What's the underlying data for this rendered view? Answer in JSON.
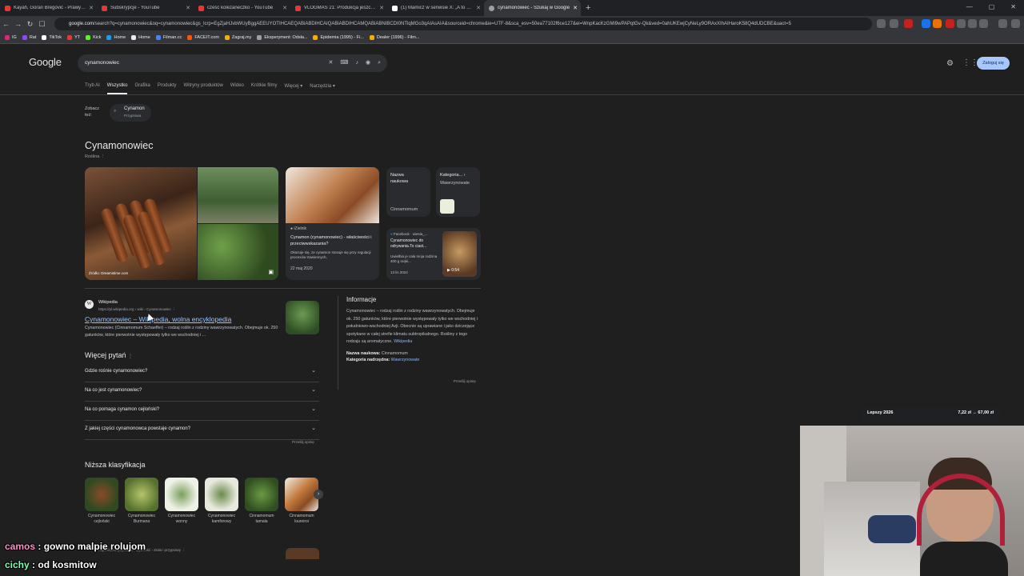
{
  "browser": {
    "tabs": [
      {
        "title": "Kayah, Goran Bregović - Prawy do",
        "color": "#e53935"
      },
      {
        "title": "Subskrypcje - YouTube",
        "color": "#e53935"
      },
      {
        "title": "cześć koleżaneczko - YouTube",
        "color": "#e53935"
      },
      {
        "title": "VLOGMAS 21: Produkcja jeszcze nie",
        "color": "#e53935"
      },
      {
        "title": "(1) Mamicz w serwisie X: „A to wiec",
        "color": "#ffffff"
      },
      {
        "title": "cynamonowiec - Szukaj w Google",
        "color": "#9aa0a6"
      }
    ],
    "url_site": "google.com",
    "url_rest": "/search?q=cynamonowiec&oq=cynamonowiec&gs_lcrp=EgZjaHJvbWUyBggAEEUYOTIHCAEQABiABDIHCAIQABiABDIHCAMQABiABNIBCDI0NTlqMGo3qAIAsAIA&sourceid=chrome&ie=UTF-8&sca_esv=50ea77102f6ce127&ei=WnpKacKzGMi9wPAPqtGv-Qk&ved=0ahUKEwjCyNeLy9ORAxXIhAIHaroK58Q4dUDCBE&uact=5",
    "bookmarks": [
      {
        "label": "IG",
        "color": "#d62976"
      },
      {
        "label": "Rat",
        "color": "#9146ff"
      },
      {
        "label": "TikTok",
        "color": "#ffffff"
      },
      {
        "label": "YT",
        "color": "#e53935"
      },
      {
        "label": "Kick",
        "color": "#53fc18"
      },
      {
        "label": "Home",
        "color": "#1d9bf0"
      },
      {
        "label": "Home",
        "color": "#e8eaed"
      },
      {
        "label": "Filman.cc",
        "color": "#4285f4"
      },
      {
        "label": "FACEIT.com",
        "color": "#ff5500"
      },
      {
        "label": "Zagraj.my",
        "color": "#f9ab00"
      },
      {
        "label": "Eksperyment: Odsła...",
        "color": "#9aa0a6"
      },
      {
        "label": "Epidemia (1995) - Fi...",
        "color": "#f9ab00"
      },
      {
        "label": "Dealer (1996) - Film...",
        "color": "#f9ab00"
      }
    ]
  },
  "google": {
    "logo": "Google",
    "query": "cynamonowiec",
    "login": "Zaloguj się",
    "nav": [
      "Tryb AI",
      "Wszystko",
      "Grafika",
      "Produkty",
      "Witryny produktów",
      "Wideo",
      "Krótkie filmy",
      "Więcej ▾",
      "Narzędzia ▾"
    ],
    "see_also_label": "Zobacz też:",
    "see_also_item": "Cynamon",
    "see_also_sub": "Przyprawa",
    "kp_title": "Cynamonowiec",
    "kp_subtitle": "Roślina",
    "img_source": "Źródło: Dreamstime.com",
    "card1": {
      "source": "iZielnik",
      "title": "Cynamon (cynamonowiec) - właściwości i przeciwwskazania?",
      "text": "Okazuje się, że cynamon stosuje się przy regulacji procesów trawiennych,",
      "date": "22 maj 2020"
    },
    "tile1": {
      "head": "Nazwa naukowa",
      "value": "Cinnamomum"
    },
    "tile2": {
      "head": "Kategoria...",
      "value": "Wawrzynowate"
    },
    "card2": {
      "source": "Facebook · wiesia_...",
      "title": "Cynamonowiec do odrywania.To ciast...",
      "text": "Uwielbia je cała moja rodzina 400 g mąki...",
      "date": "13 lis 2024",
      "duration": "0:54"
    },
    "result": {
      "site": "Wikipedia",
      "url": "https://pl.wikipedia.org › wiki › Cynamonowiec",
      "title": "Cynamonowiec – Wikipedia, wolna encyklopedia",
      "desc": "Cynamonowiec (Cinnamomum Schaeffer) – rodzaj roślin z rodziny wawrzynowatych. Obejmuje ok. 250 gatunków, które pierwotnie występowały tylko we wschodniej i ..."
    },
    "info": {
      "heading": "Informacje",
      "text": "Cynamonowiec – rodzaj roślin z rodziny wawrzynowatych. Obejmuje ok. 250 gatunków, które pierwotnie występowały tylko we wschodniej i południowo-wschodniej Azji. Obecnie są uprawiane i jako dziczejące spotykane w całej strefie klimatu subtropikalnego. Rośliny z tego rodzaju są aromatyczne.",
      "link": "Wikipedia",
      "k1": "Nazwa naukowa:",
      "v1": "Cinnamomum",
      "k2": "Kategoria nadrzędna:",
      "v2": "Wawrzynowate",
      "feedback": "Prześlij opinię"
    },
    "paa_title": "Więcej pytań",
    "paa": [
      "Gdzie rośnie cynamonowiec?",
      "Na co jest cynamonowiec?",
      "Na co pomaga cynamon cejloński?",
      "Z jakiej części cynamonowca powstaje cynamon?"
    ],
    "paa_feedback": "Prześlij opinię",
    "lower_title": "Niższa klasyfikacja",
    "lower": [
      {
        "label": "Cynamonowiec cejloński",
        "color": "#5a3a22"
      },
      {
        "label": "Cynamonowiec Burmana",
        "color": "#8aa04a"
      },
      {
        "label": "Cynamonowiec wonny",
        "color": "#e8ecdf"
      },
      {
        "label": "Cynamonowiec kamforowy",
        "color": "#dfe4d2"
      },
      {
        "label": "Cinnamomum tamala",
        "color": "#4f7a34"
      },
      {
        "label": "Cinnamomum loureiroi",
        "color": "#b9763a"
      }
    ],
    "next_result": "https://dietetycy.org.pl › Żywność › Zioła i przyprawy"
  },
  "overlay": {
    "price_label": "Lepszy 2026",
    "price_value": "7,22 zł → 67,00 zł",
    "chat": [
      {
        "user": "camos",
        "msg": "gowno malpie rolujom"
      },
      {
        "user": "cichy",
        "msg": "od kosmitow"
      }
    ]
  }
}
